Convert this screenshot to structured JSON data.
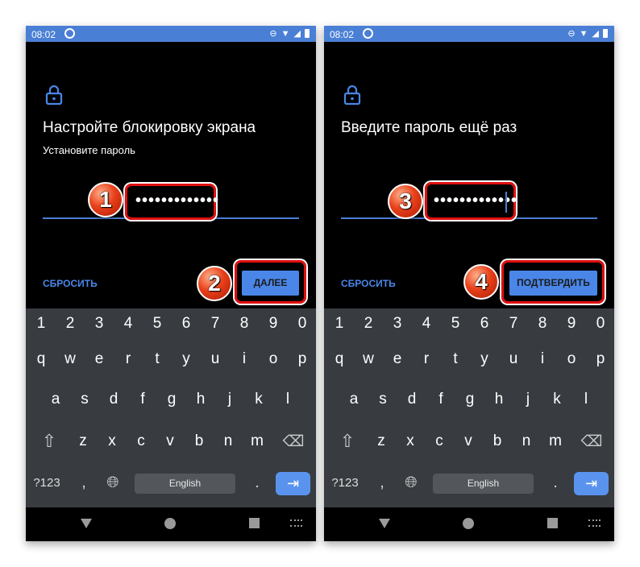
{
  "status": {
    "time": "08:02"
  },
  "keyboard": {
    "rows": [
      [
        "1",
        "2",
        "3",
        "4",
        "5",
        "6",
        "7",
        "8",
        "9",
        "0"
      ],
      [
        "q",
        "w",
        "e",
        "r",
        "t",
        "y",
        "u",
        "i",
        "o",
        "p"
      ],
      [
        "a",
        "s",
        "d",
        "f",
        "g",
        "h",
        "j",
        "k",
        "l"
      ],
      [
        "z",
        "x",
        "c",
        "v",
        "b",
        "n",
        "m"
      ]
    ],
    "symbols_label": "?123",
    "comma": ",",
    "space_label": "English",
    "period": "."
  },
  "screens": [
    {
      "title": "Настройте блокировку экрана",
      "subtitle": "Установите пароль",
      "password_masked": "•••••••••••••",
      "reset_label": "СБРОСИТЬ",
      "next_label": "ДАЛЕЕ",
      "badges": [
        "1",
        "2"
      ]
    },
    {
      "title": "Введите пароль ещё раз",
      "subtitle": "",
      "password_masked": "•••••••••••••",
      "reset_label": "СБРОСИТЬ",
      "next_label": "ПОДТВЕРДИТЬ",
      "badges": [
        "3",
        "4"
      ]
    }
  ],
  "colors": {
    "accent": "#4a86e8",
    "status_bar": "#4a7fd6",
    "callout": "#e01010",
    "keyboard_bg": "#383c41"
  }
}
